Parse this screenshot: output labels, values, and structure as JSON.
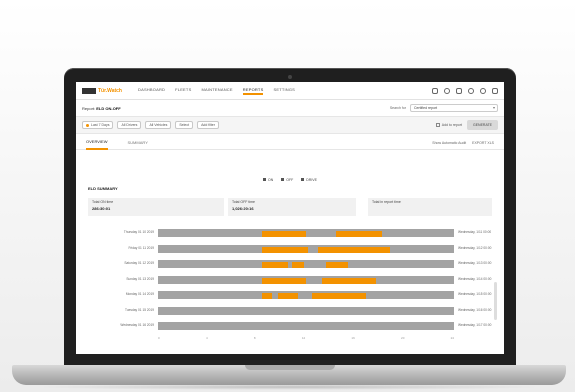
{
  "header": {
    "logo_text": "Tür.Watch",
    "nav": [
      "DASHBOARD",
      "FLEETS",
      "MAINTENANCE",
      "REPORTS",
      "SETTINGS"
    ],
    "active_nav_index": 3
  },
  "subbar": {
    "title_prefix": "Report:",
    "title_value": "ELD ON-OFF",
    "search_label": "Search for",
    "search_value": "Certified report"
  },
  "filters": {
    "chips": [
      "Last 7 Days",
      "All Drivers",
      "All Vehicles",
      "Select",
      "Add filter"
    ],
    "checkbox_label": "Add to report",
    "generate_label": "GENERATE"
  },
  "tabs": {
    "items": [
      "OVERVIEW",
      "SUMMARY"
    ],
    "active_index": 0,
    "right_label": "Show Automatic Audit",
    "export_label": "EXPORT XLS"
  },
  "legend": [
    "ON",
    "OFF",
    "DRIVE"
  ],
  "section": {
    "title": "ELD SUMMARY"
  },
  "stats": [
    {
      "label": "Total ON time",
      "value": "286:30:01"
    },
    {
      "label": "Total OFF time",
      "value": "1,026:20:16"
    },
    {
      "label": "Total in report time",
      "value": ""
    }
  ],
  "rows": [
    {
      "label": "Thursday 01 10 2019",
      "end": "Wednesday, 1/11 00:00"
    },
    {
      "label": "Friday 01 11 2019",
      "end": "Wednesday, 1/12 00:00"
    },
    {
      "label": "Saturday 01 12 2019",
      "end": "Wednesday, 1/13 00:00"
    },
    {
      "label": "Sunday 01 13 2019",
      "end": "Wednesday, 1/14 00:00"
    },
    {
      "label": "Monday 01 14 2019",
      "end": "Wednesday, 1/15 00:00"
    },
    {
      "label": "Tuesday 01 15 2019",
      "end": "Wednesday, 1/16 00:00"
    },
    {
      "label": "Wednesday 01 16 2019",
      "end": "Wednesday, 1/17 00:00"
    }
  ],
  "axis_ticks": [
    "0",
    "4",
    "8",
    "12",
    "16",
    "20",
    "24"
  ],
  "colors": {
    "accent": "#f39200",
    "bar": "#a3a3a3"
  }
}
